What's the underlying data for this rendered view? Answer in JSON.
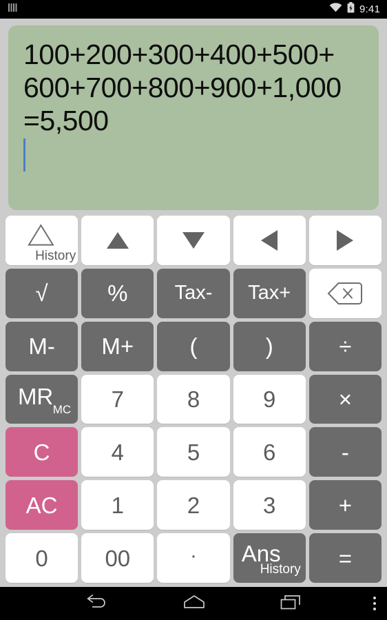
{
  "status_bar": {
    "sim_icon": "sim-signal-icon",
    "wifi_icon": "wifi-icon",
    "battery_icon": "battery-charging-icon",
    "time": "9:41"
  },
  "display": {
    "background_color": "#a9bf9f",
    "text_color": "#0e0e0e",
    "caret_color": "#4d7dc4",
    "lines": [
      "100+200+300+400+500+",
      "600+700+800+900+1,000",
      "=5,500"
    ],
    "expression": "100+200+300+400+500+600+700+800+900+1,000=5,500",
    "result": "5,500",
    "caret_visible": true
  },
  "colors": {
    "page_background": "#cccccc",
    "key_white": "#ffffff",
    "key_white_text": "#5c5c5c",
    "key_gray": "#6b6b6b",
    "key_gray_text": "#ffffff",
    "key_pink": "#d1628d",
    "key_pink_text": "#ffffff",
    "system_bar": "#000000"
  },
  "keypad": {
    "rows": [
      {
        "name": "row-navigation",
        "keys": [
          {
            "name": "history-key",
            "label": "History",
            "icon": "triangle-up-outline-icon",
            "style": "white",
            "kind": "history"
          },
          {
            "name": "arrow-up-key",
            "label": "",
            "icon": "triangle-up-icon",
            "style": "white",
            "kind": "arrow-up"
          },
          {
            "name": "arrow-down-key",
            "label": "",
            "icon": "triangle-down-icon",
            "style": "white",
            "kind": "arrow-down"
          },
          {
            "name": "arrow-left-key",
            "label": "",
            "icon": "triangle-left-icon",
            "style": "white",
            "kind": "arrow-left"
          },
          {
            "name": "arrow-right-key",
            "label": "",
            "icon": "triangle-right-icon",
            "style": "white",
            "kind": "arrow-right"
          }
        ]
      },
      {
        "name": "row-functions",
        "keys": [
          {
            "name": "sqrt-key",
            "label": "√",
            "style": "gray",
            "kind": "text"
          },
          {
            "name": "percent-key",
            "label": "%",
            "style": "gray",
            "kind": "text"
          },
          {
            "name": "tax-minus-key",
            "label": "Tax-",
            "style": "gray",
            "kind": "text-sm"
          },
          {
            "name": "tax-plus-key",
            "label": "Tax+",
            "style": "gray",
            "kind": "text-sm"
          },
          {
            "name": "backspace-key",
            "label": "",
            "icon": "backspace-icon",
            "style": "white",
            "kind": "backspace"
          }
        ]
      },
      {
        "name": "row-memory-paren",
        "keys": [
          {
            "name": "memory-minus-key",
            "label": "M-",
            "style": "gray",
            "kind": "text"
          },
          {
            "name": "memory-plus-key",
            "label": "M+",
            "style": "gray",
            "kind": "text"
          },
          {
            "name": "paren-open-key",
            "label": "(",
            "style": "gray",
            "kind": "text"
          },
          {
            "name": "paren-close-key",
            "label": ")",
            "style": "gray",
            "kind": "text"
          },
          {
            "name": "divide-key",
            "label": "÷",
            "style": "gray",
            "kind": "text"
          }
        ]
      },
      {
        "name": "row-789",
        "keys": [
          {
            "name": "memory-recall-key",
            "label": "MR",
            "sublabel": "MC",
            "style": "gray",
            "kind": "compound"
          },
          {
            "name": "digit-7-key",
            "label": "7",
            "style": "white",
            "kind": "text"
          },
          {
            "name": "digit-8-key",
            "label": "8",
            "style": "white",
            "kind": "text"
          },
          {
            "name": "digit-9-key",
            "label": "9",
            "style": "white",
            "kind": "text"
          },
          {
            "name": "multiply-key",
            "label": "×",
            "style": "gray",
            "kind": "text"
          }
        ]
      },
      {
        "name": "row-456",
        "keys": [
          {
            "name": "clear-key",
            "label": "C",
            "style": "pink",
            "kind": "text"
          },
          {
            "name": "digit-4-key",
            "label": "4",
            "style": "white",
            "kind": "text"
          },
          {
            "name": "digit-5-key",
            "label": "5",
            "style": "white",
            "kind": "text"
          },
          {
            "name": "digit-6-key",
            "label": "6",
            "style": "white",
            "kind": "text"
          },
          {
            "name": "minus-key",
            "label": "-",
            "style": "gray",
            "kind": "text"
          }
        ]
      },
      {
        "name": "row-123",
        "keys": [
          {
            "name": "all-clear-key",
            "label": "AC",
            "style": "pink",
            "kind": "text"
          },
          {
            "name": "digit-1-key",
            "label": "1",
            "style": "white",
            "kind": "text"
          },
          {
            "name": "digit-2-key",
            "label": "2",
            "style": "white",
            "kind": "text"
          },
          {
            "name": "digit-3-key",
            "label": "3",
            "style": "white",
            "kind": "text"
          },
          {
            "name": "plus-key",
            "label": "+",
            "style": "gray",
            "kind": "text"
          }
        ]
      },
      {
        "name": "row-zero-equals",
        "keys": [
          {
            "name": "digit-0-key",
            "label": "0",
            "style": "white",
            "kind": "text"
          },
          {
            "name": "double-zero-key",
            "label": "00",
            "style": "white",
            "kind": "text"
          },
          {
            "name": "decimal-point-key",
            "label": "·",
            "style": "white",
            "kind": "dot"
          },
          {
            "name": "answer-key",
            "label": "Ans",
            "sublabel": "History",
            "style": "gray",
            "kind": "compound-ans"
          },
          {
            "name": "equals-key",
            "label": "=",
            "style": "gray",
            "kind": "text"
          }
        ]
      }
    ]
  },
  "nav_bar": {
    "back_icon": "back-arrow-icon",
    "home_icon": "home-icon",
    "recents_icon": "recent-apps-icon",
    "overflow_icon": "overflow-menu-icon"
  }
}
